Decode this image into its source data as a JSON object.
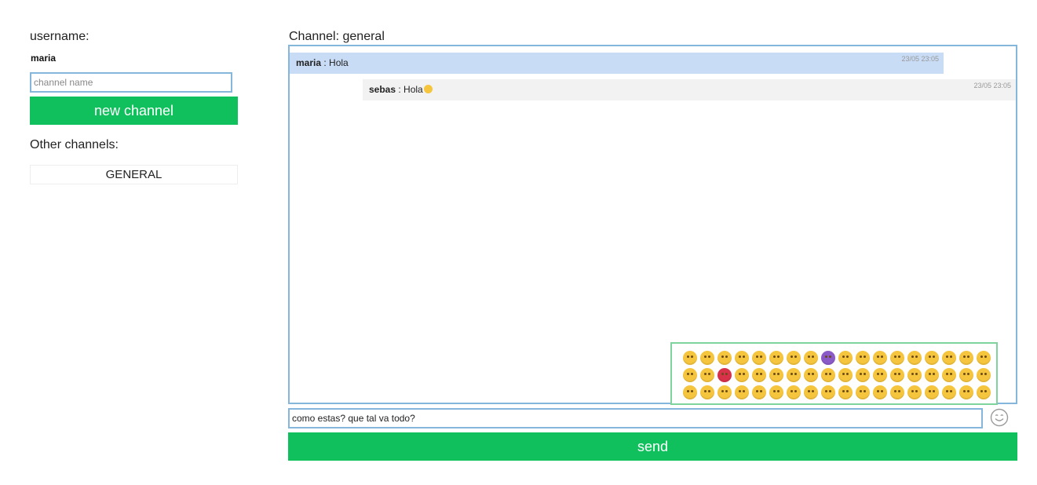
{
  "sidebar": {
    "username_label": "username:",
    "username": "maria",
    "channel_input_placeholder": "channel name",
    "new_channel_label": "new channel",
    "other_channels_label": "Other channels:",
    "channels": [
      "GENERAL"
    ]
  },
  "chat": {
    "title": "Channel: general",
    "messages": [
      {
        "user": "maria",
        "sep": " : ",
        "text": "Hola",
        "time": "23/05 23:05"
      },
      {
        "user": "sebas",
        "sep": " : ",
        "text": "Hola",
        "time": "23/05 23:05"
      }
    ],
    "input_value": "como estas? que tal va todo?",
    "send_label": "send"
  },
  "icons": {
    "smiley": "smiley-icon",
    "emoji": "emoji-icon"
  },
  "colors": {
    "accent_green": "#0fc05c",
    "border_blue": "#85b6dc",
    "own_message_bg": "#c9dcf5",
    "other_message_bg": "#f2f2f2",
    "emoji_panel_border": "#7fd49e"
  }
}
